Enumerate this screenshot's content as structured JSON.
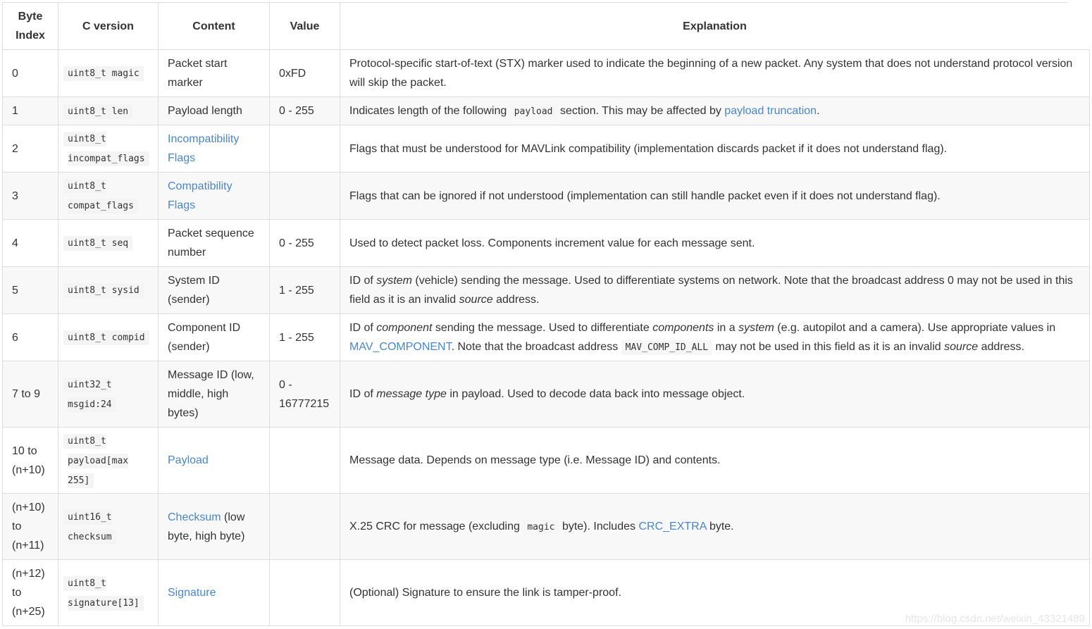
{
  "headers": {
    "byte_index": "Byte Index",
    "c_version": "C version",
    "content": "Content",
    "value": "Value",
    "explanation": "Explanation"
  },
  "rows": [
    {
      "byte": "0",
      "code": "uint8_t magic",
      "content": "Packet start marker",
      "value": "0xFD",
      "expl": {
        "t1": "Protocol-specific start-of-text (STX) marker used to indicate the beginning of a new packet. Any system that does not understand protocol version will skip the packet."
      }
    },
    {
      "byte": "1",
      "code": "uint8_t len",
      "content": "Payload length",
      "value": "0 - 255",
      "expl": {
        "t1": "Indicates length of the following",
        "code1": "payload",
        "t2": "section. This may be affected by",
        "link1": "payload truncation",
        "t3": "."
      }
    },
    {
      "byte": "2",
      "code": "uint8_t incompat_flags",
      "content_link": "Incompatibility Flags",
      "value": "",
      "expl": {
        "t1": "Flags that must be understood for MAVLink compatibility (implementation discards packet if it does not understand flag)."
      }
    },
    {
      "byte": "3",
      "code": "uint8_t compat_flags",
      "content_link": "Compatibility Flags",
      "value": "",
      "expl": {
        "t1": "Flags that can be ignored if not understood (implementation can still handle packet even if it does not understand flag)."
      }
    },
    {
      "byte": "4",
      "code": "uint8_t seq",
      "content": "Packet sequence number",
      "value": "0 - 255",
      "expl": {
        "t1": "Used to detect packet loss. Components increment value for each message sent."
      }
    },
    {
      "byte": "5",
      "code": "uint8_t sysid",
      "content": "System ID (sender)",
      "value": "1 - 255",
      "expl": {
        "t1": "ID of",
        "em1": "system",
        "t2": "(vehicle) sending the message. Used to differentiate systems on network. Note that the broadcast address 0 may not be used in this field as it is an invalid",
        "em2": "source",
        "t3": "address."
      }
    },
    {
      "byte": "6",
      "code": "uint8_t compid",
      "content": "Component ID (sender)",
      "value": "1 - 255",
      "expl": {
        "t1": "ID of",
        "em1": "component",
        "t2": "sending the message. Used to differentiate",
        "em2": "components",
        "t3": "in a",
        "em3": "system",
        "t4": "(e.g. autopilot and a camera). Use appropriate values in",
        "link1": "MAV_COMPONENT",
        "t5": ". Note that the broadcast address",
        "code1": "MAV_COMP_ID_ALL",
        "t6": "may not be used in this field as it is an invalid",
        "em4": "source",
        "t7": "address."
      }
    },
    {
      "byte": "7 to 9",
      "code": "uint32_t msgid:24",
      "content": "Message ID (low, middle, high bytes)",
      "value": "0 - 16777215",
      "expl": {
        "t1": "ID of",
        "em1": "message type",
        "t2": "in payload. Used to decode data back into message object."
      }
    },
    {
      "byte": "10 to (n+10)",
      "code": "uint8_t payload[max 255]",
      "content_link": "Payload",
      "value": "",
      "expl": {
        "t1": "Message data. Depends on message type (i.e. Message ID) and contents."
      }
    },
    {
      "byte": "(n+10) to (n+11)",
      "code": "uint16_t checksum",
      "content_link": "Checksum",
      "content_rest": "(low byte, high byte)",
      "value": "",
      "expl": {
        "t1": "X.25 CRC for message (excluding",
        "code1": "magic",
        "t2": "byte). Includes",
        "link1": "CRC_EXTRA",
        "t3": "byte."
      }
    },
    {
      "byte": "(n+12) to (n+25)",
      "code": "uint8_t signature[13]",
      "content_link": "Signature",
      "value": "",
      "expl": {
        "t1": "(Optional) Signature to ensure the link is tamper-proof."
      }
    }
  ],
  "watermark": "https://blog.csdn.net/weixin_43321489",
  "colors": {
    "link": "#4a86c8",
    "border": "#dddddd",
    "alt_row": "#f8f8f8",
    "text": "#333333"
  }
}
